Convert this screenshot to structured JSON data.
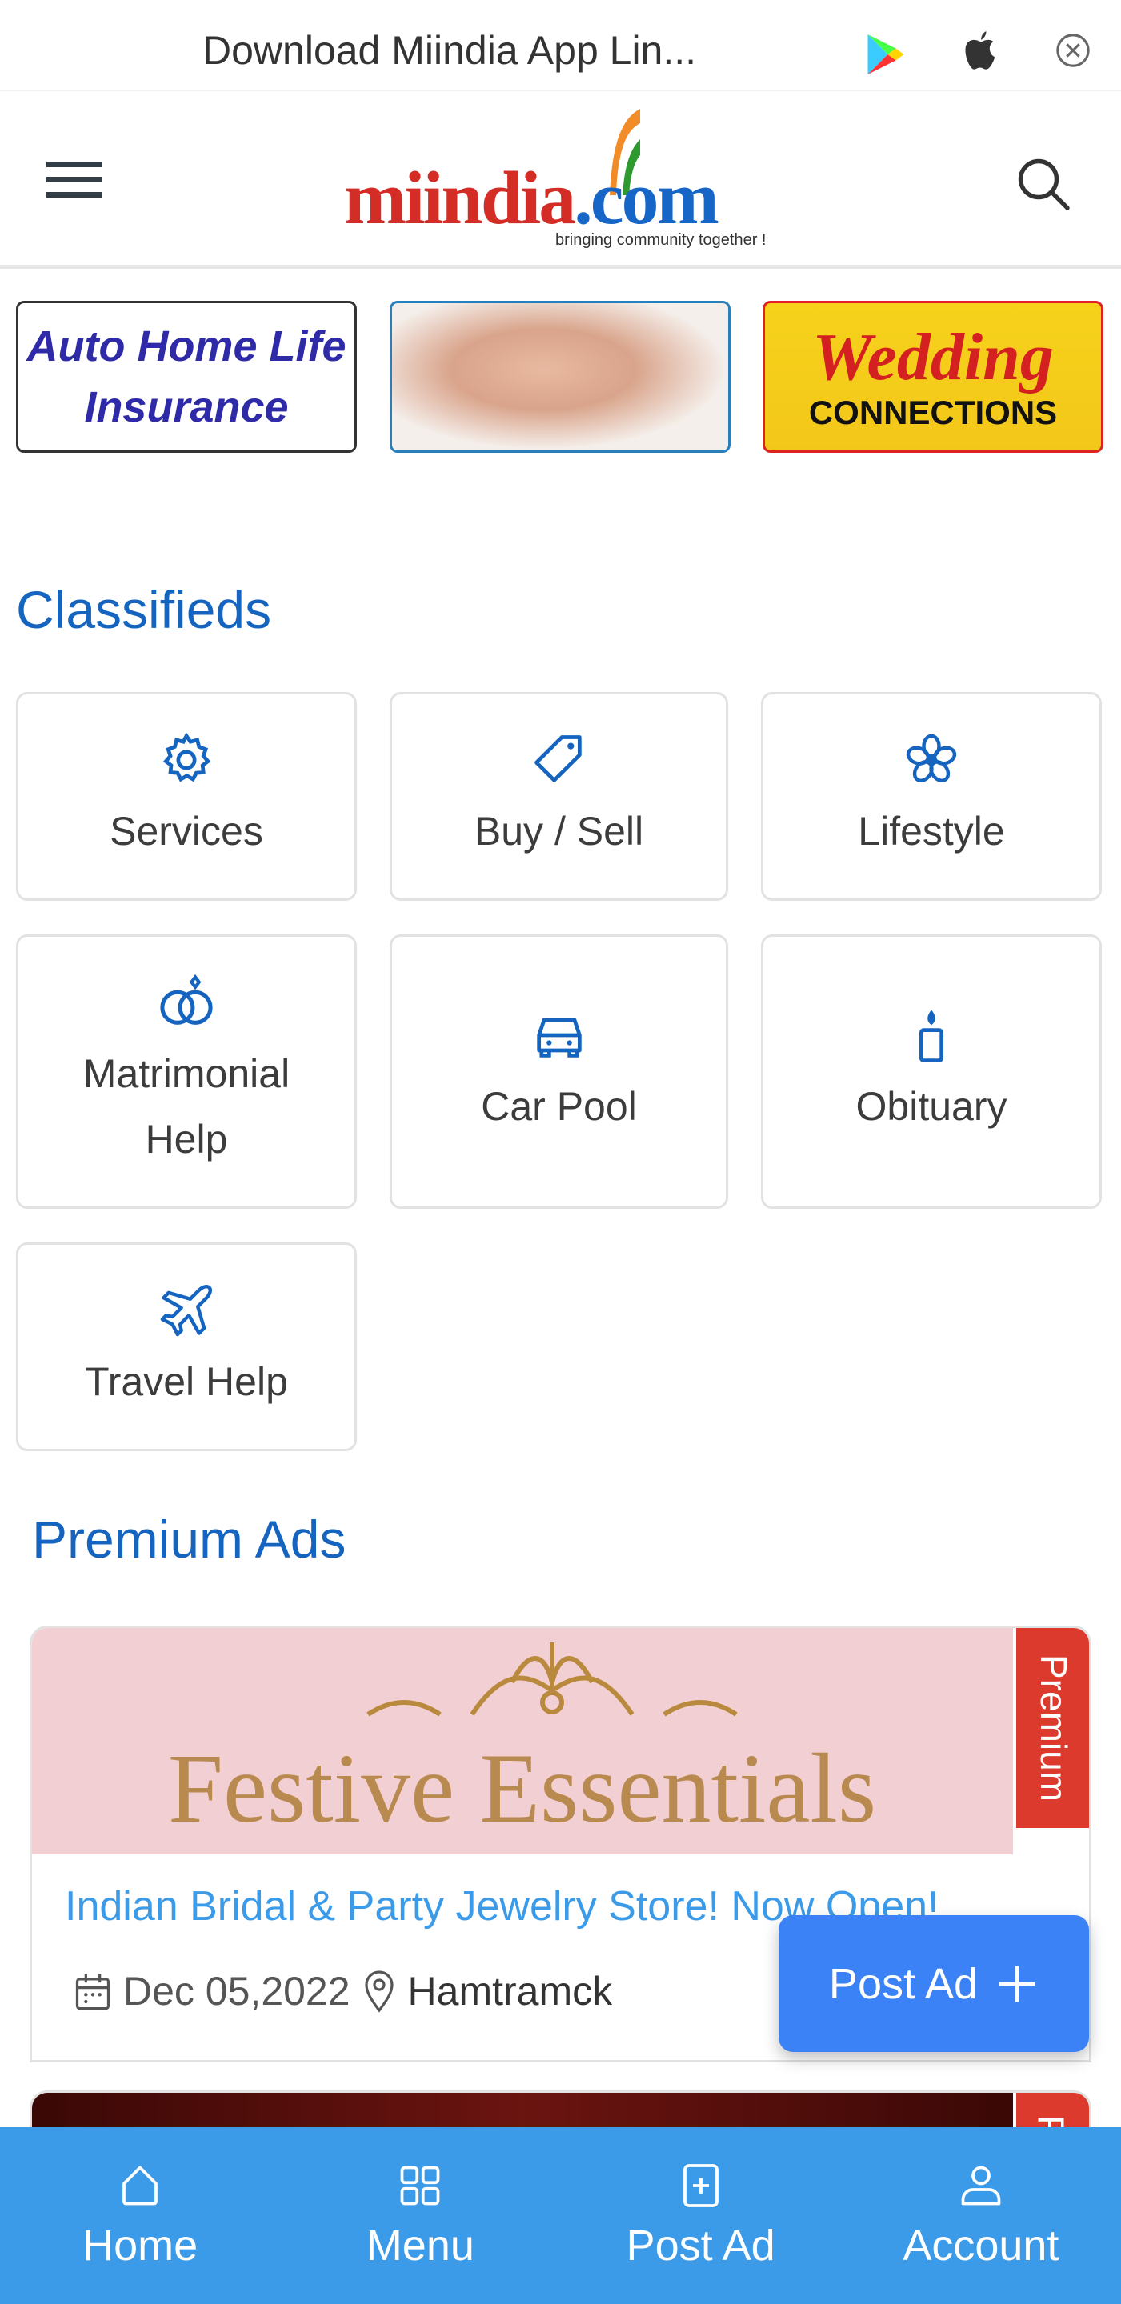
{
  "topbar": {
    "text": "Download Miindia App Lin...",
    "icons": [
      "google-play-icon",
      "apple-icon",
      "close-icon"
    ]
  },
  "header": {
    "logo_text": "miindia.com",
    "logo_tagline": "bringing community together !",
    "menu_icon": "hamburger-icon",
    "search_icon": "search-icon"
  },
  "banners": [
    {
      "line1": "Auto Home Life",
      "line2": "Insurance"
    },
    {
      "alt": "baby"
    },
    {
      "line1": "Wedding",
      "line2": "CONNECTIONS"
    }
  ],
  "classifieds": {
    "title": "Classifieds",
    "items": [
      {
        "label": "Services",
        "icon": "gear-icon"
      },
      {
        "label": "Buy / Sell",
        "icon": "tag-icon"
      },
      {
        "label": "Lifestyle",
        "icon": "flower-icon"
      },
      {
        "label": "Matrimonial Help",
        "icon": "rings-icon"
      },
      {
        "label": "Car Pool",
        "icon": "car-icon"
      },
      {
        "label": "Obituary",
        "icon": "candle-icon"
      },
      {
        "label": "Travel Help",
        "icon": "airplane-icon"
      }
    ]
  },
  "premium_ads": {
    "title": "Premium Ads",
    "ads": [
      {
        "image_text": "Festive Essentials",
        "badge": "Premium",
        "title": "Indian Bridal & Party Jewelry Store! Now Open!",
        "date": "Dec 05,2022",
        "location": "Hamtramck"
      },
      {
        "badge": "P"
      }
    ]
  },
  "fab": {
    "label": "Post Ad"
  },
  "bottom_nav": [
    {
      "label": "Home",
      "icon": "home-icon"
    },
    {
      "label": "Menu",
      "icon": "grid-icon"
    },
    {
      "label": "Post Ad",
      "icon": "plus-square-icon"
    },
    {
      "label": "Account",
      "icon": "user-icon"
    }
  ],
  "colors": {
    "primary": "#1565c0",
    "nav": "#3b9be8",
    "fab": "#3b82f6",
    "badge": "#dc3a2c",
    "link": "#3c9be8"
  }
}
